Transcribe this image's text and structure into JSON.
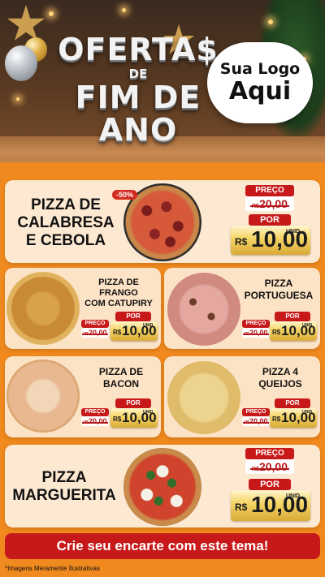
{
  "header": {
    "title_line1": "OFERTA$",
    "title_line2": "DE",
    "title_line3": "FIM DE ANO",
    "logo_line1": "Sua Logo",
    "logo_line2": "Aqui"
  },
  "products": {
    "calabresa": {
      "name_line1": "PIZZA DE",
      "name_line2": "CALABRESA",
      "name_line3": "E CEBOLA",
      "discount": "-50%",
      "old_label": "PREÇO",
      "old_currency": "R$",
      "old_price": "20,00",
      "new_label": "POR",
      "new_currency": "R$",
      "new_price": "10,00",
      "unit": "UNID"
    },
    "frango": {
      "name_line1": "PIZZA DE FRANGO",
      "name_line2": "COM CATUPIRY",
      "old_label": "PREÇO",
      "old_currency": "R$",
      "old_price": "20,00",
      "new_label": "POR",
      "new_currency": "R$",
      "new_price": "10,00",
      "unit": "UNID"
    },
    "portuguesa": {
      "name_line1": "PIZZA",
      "name_line2": "PORTUGUESA",
      "old_label": "PREÇO",
      "old_currency": "R$",
      "old_price": "20,00",
      "new_label": "POR",
      "new_currency": "R$",
      "new_price": "10,00",
      "unit": "UNID"
    },
    "bacon": {
      "name_line1": "PIZZA DE",
      "name_line2": "BACON",
      "old_label": "PREÇO",
      "old_currency": "R$",
      "old_price": "20,00",
      "new_label": "POR",
      "new_currency": "R$",
      "new_price": "10,00",
      "unit": "UNID"
    },
    "queijos": {
      "name_line1": "PIZZA 4",
      "name_line2": "QUEIJOS",
      "old_label": "PREÇO",
      "old_currency": "R$",
      "old_price": "20,00",
      "new_label": "POR",
      "new_currency": "R$",
      "new_price": "10,00",
      "unit": "UNID"
    },
    "marguerita": {
      "name_line1": "PIZZA",
      "name_line2": "MARGUERITA",
      "old_label": "PREÇO",
      "old_currency": "R$",
      "old_price": "20,00",
      "new_label": "POR",
      "new_currency": "R$",
      "new_price": "10,00",
      "unit": "UNID"
    }
  },
  "footer": {
    "cta_label": "Crie seu encarte com este tema!",
    "note": "*Imagens Meramente Ilustrativas"
  },
  "colors": {
    "background": "#f08a1e",
    "card": "#fde3c6",
    "accent_red": "#c8191a",
    "gold": "#d9a934"
  }
}
